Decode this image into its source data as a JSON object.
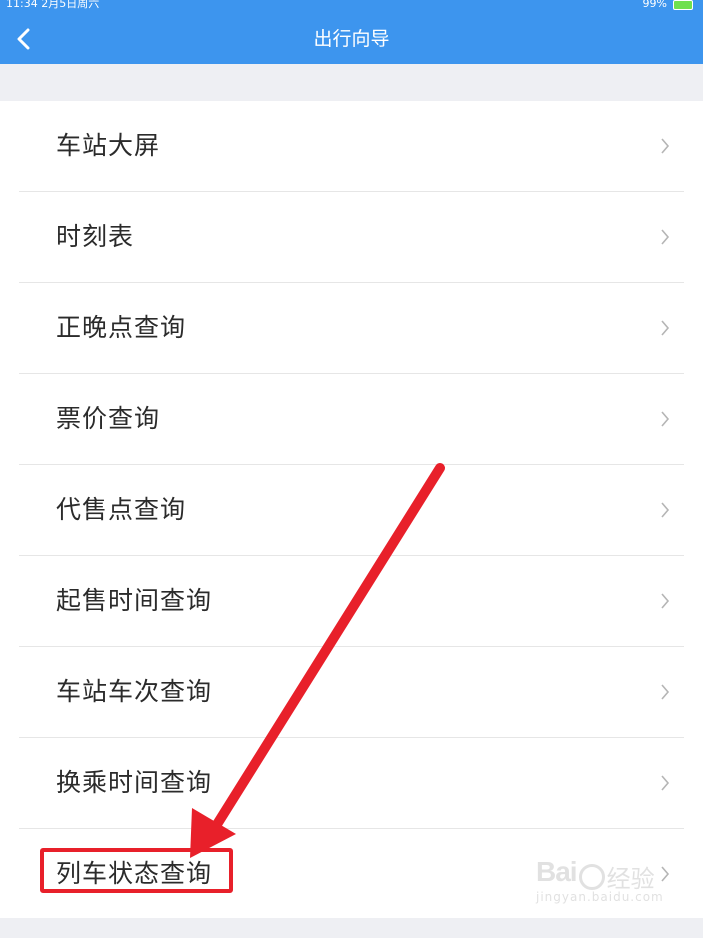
{
  "status_bar": {
    "time": "11:34",
    "date": "2月5日周六",
    "battery_percent": "99%"
  },
  "nav": {
    "title": "出行向导",
    "back_icon": "chevron-left-icon"
  },
  "menu": {
    "items": [
      {
        "label": "车站大屏"
      },
      {
        "label": "时刻表"
      },
      {
        "label": "正晚点查询"
      },
      {
        "label": "票价查询"
      },
      {
        "label": "代售点查询"
      },
      {
        "label": "起售时间查询"
      },
      {
        "label": "车站车次查询"
      },
      {
        "label": "换乘时间查询"
      },
      {
        "label": "列车状态查询"
      }
    ],
    "chevron_icon": "chevron-right-icon"
  },
  "annotation": {
    "arrow_color": "#e8202a",
    "highlight_color": "#e8202a"
  },
  "watermark": {
    "brand": "Bai",
    "brand_suffix": "经验",
    "url": "jingyan.baidu.com"
  },
  "colors": {
    "nav_background": "#3d95ee",
    "page_background": "#eeeff3",
    "text": "#2b2b2b"
  }
}
